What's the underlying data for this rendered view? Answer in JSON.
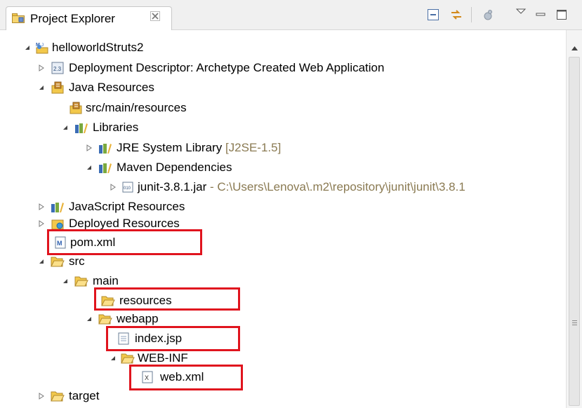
{
  "view": {
    "title": "Project Explorer"
  },
  "toolbar": {
    "collapse_all": "collapse-all-icon",
    "link_with_editor": "link-with-editor-icon",
    "focus": "focus-on-active-task-icon",
    "view_menu": "view-menu-icon",
    "minimize": "minimize-icon",
    "maximize": "maximize-icon"
  },
  "tree": {
    "project": "helloworldStruts2",
    "deployment_descriptor": "Deployment Descriptor: Archetype Created Web Application",
    "java_resources": "Java Resources",
    "src_main_resources": "src/main/resources",
    "libraries": "Libraries",
    "jre_library": "JRE System Library",
    "jre_version": "[J2SE-1.5]",
    "maven_dependencies": "Maven Dependencies",
    "junit_jar": "junit-3.8.1.jar",
    "junit_path": " - C:\\Users\\Lenova\\.m2\\repository\\junit\\junit\\3.8.1",
    "javascript_resources": "JavaScript Resources",
    "deployed_resources": "Deployed Resources",
    "pom": "pom.xml",
    "src": "src",
    "main": "main",
    "resources": "resources",
    "webapp": "webapp",
    "index": "index.jsp",
    "web_inf": "WEB-INF",
    "web_xml": "web.xml",
    "target": "target"
  },
  "colors": {
    "highlight": "#e0141e",
    "folder": "#f2c84b",
    "decoration": "#8a7a52"
  }
}
